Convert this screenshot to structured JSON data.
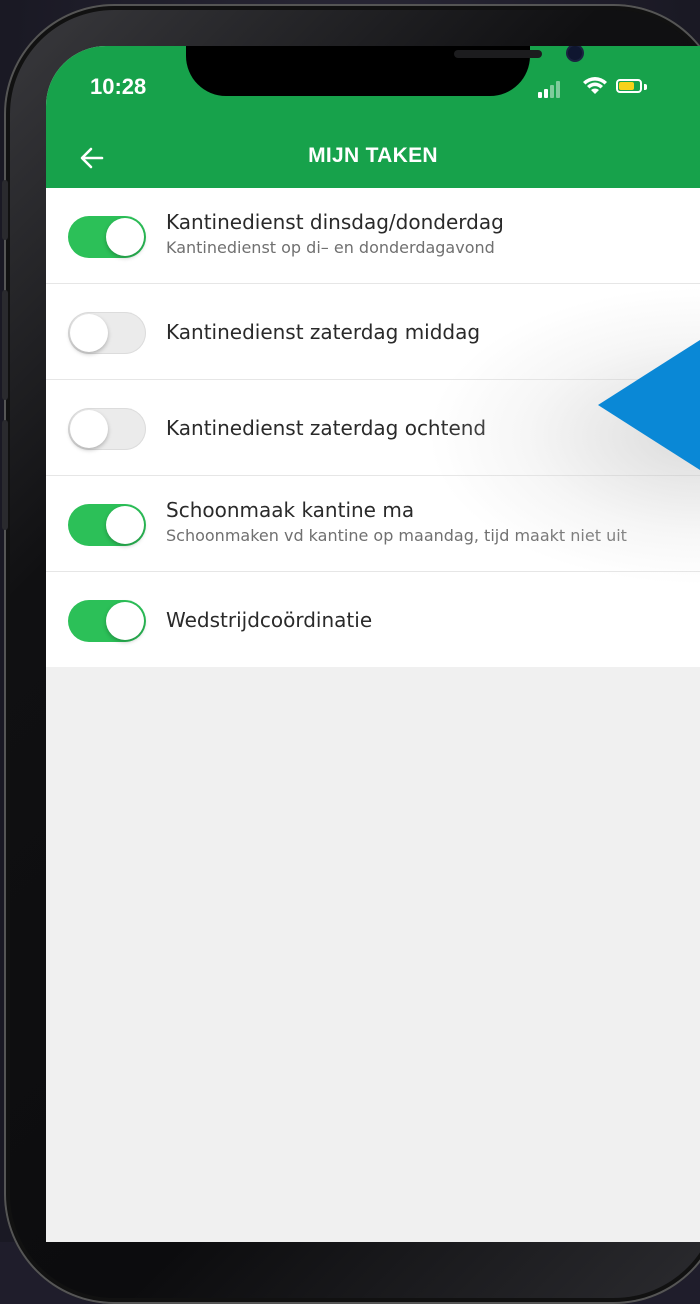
{
  "status_bar": {
    "time": "10:28"
  },
  "app_bar": {
    "title": "MIJN TAKEN",
    "back_icon": "arrow-left-icon"
  },
  "colors": {
    "primary_green": "#17a24b",
    "toggle_on": "#2cc058",
    "toggle_off": "#ebebeb",
    "pointer_blue": "#0a88d6",
    "battery_yellow": "#f8d21a"
  },
  "tasks": [
    {
      "title": "Kantinedienst dinsdag/donderdag",
      "subtitle": "Kantinedienst op di– en  donderdagavond",
      "enabled": true
    },
    {
      "title": "Kantinedienst zaterdag middag",
      "subtitle": "",
      "enabled": false
    },
    {
      "title": "Kantinedienst zaterdag ochtend",
      "subtitle": "",
      "enabled": false
    },
    {
      "title": "Schoonmaak kantine ma",
      "subtitle": "Schoonmaken vd kantine op maandag, tijd maakt niet uit",
      "enabled": true
    },
    {
      "title": "Wedstrijdcoördinatie",
      "subtitle": "",
      "enabled": true
    }
  ]
}
